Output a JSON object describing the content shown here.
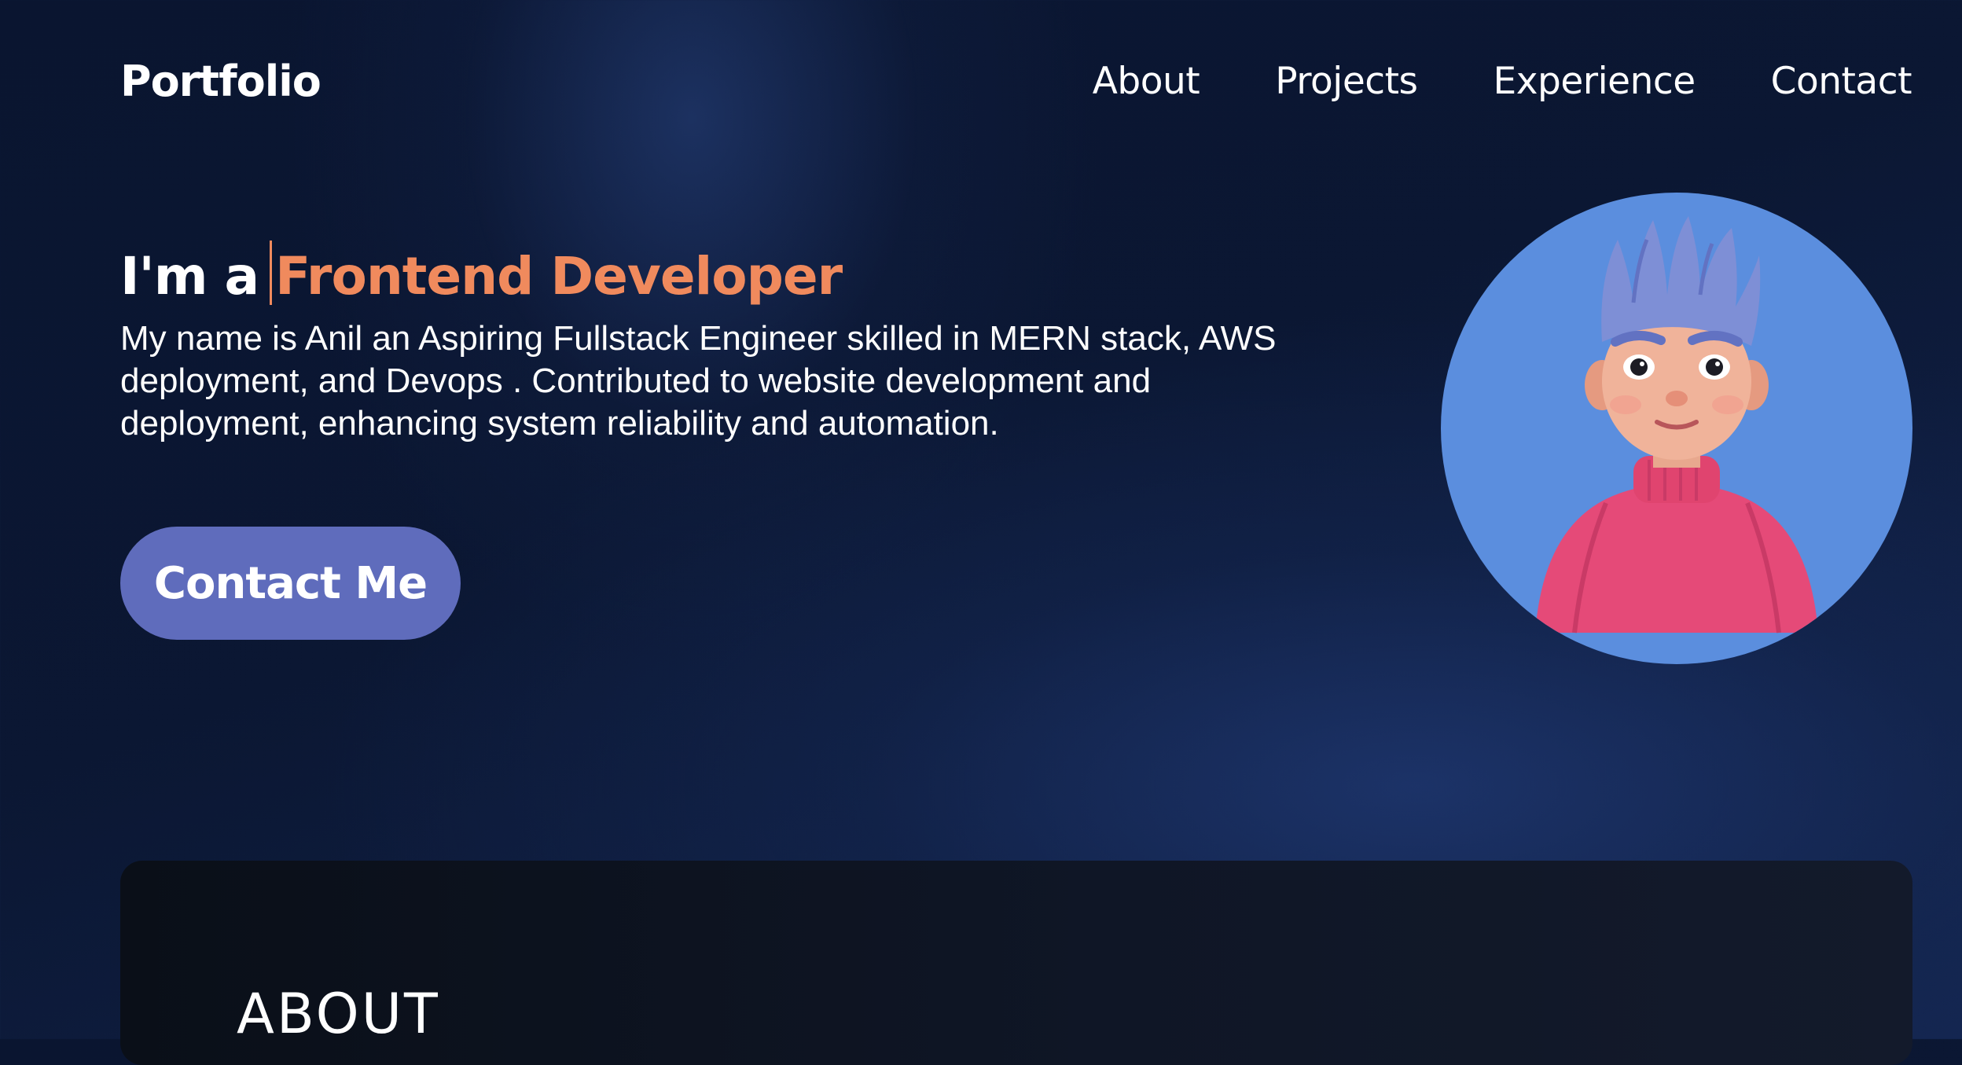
{
  "nav": {
    "brand": "Portfolio",
    "links": [
      "About",
      "Projects",
      "Experience",
      "Contact"
    ]
  },
  "hero": {
    "prefix": "I'm a",
    "role": "Frontend Developer",
    "description": "My name is Anil an Aspiring Fullstack Engineer skilled in MERN stack, AWS deployment, and Devops . Contributed to website development and deployment, enhancing system reliability and automation.",
    "cta_label": "Contact Me"
  },
  "about": {
    "heading": "ABOUT"
  },
  "colors": {
    "accent": "#f08a5d",
    "button": "#5f6cbc",
    "avatar_bg": "#5b8ede",
    "background": "#0b1733"
  },
  "icons": {
    "avatar": "avatar-illustration"
  }
}
